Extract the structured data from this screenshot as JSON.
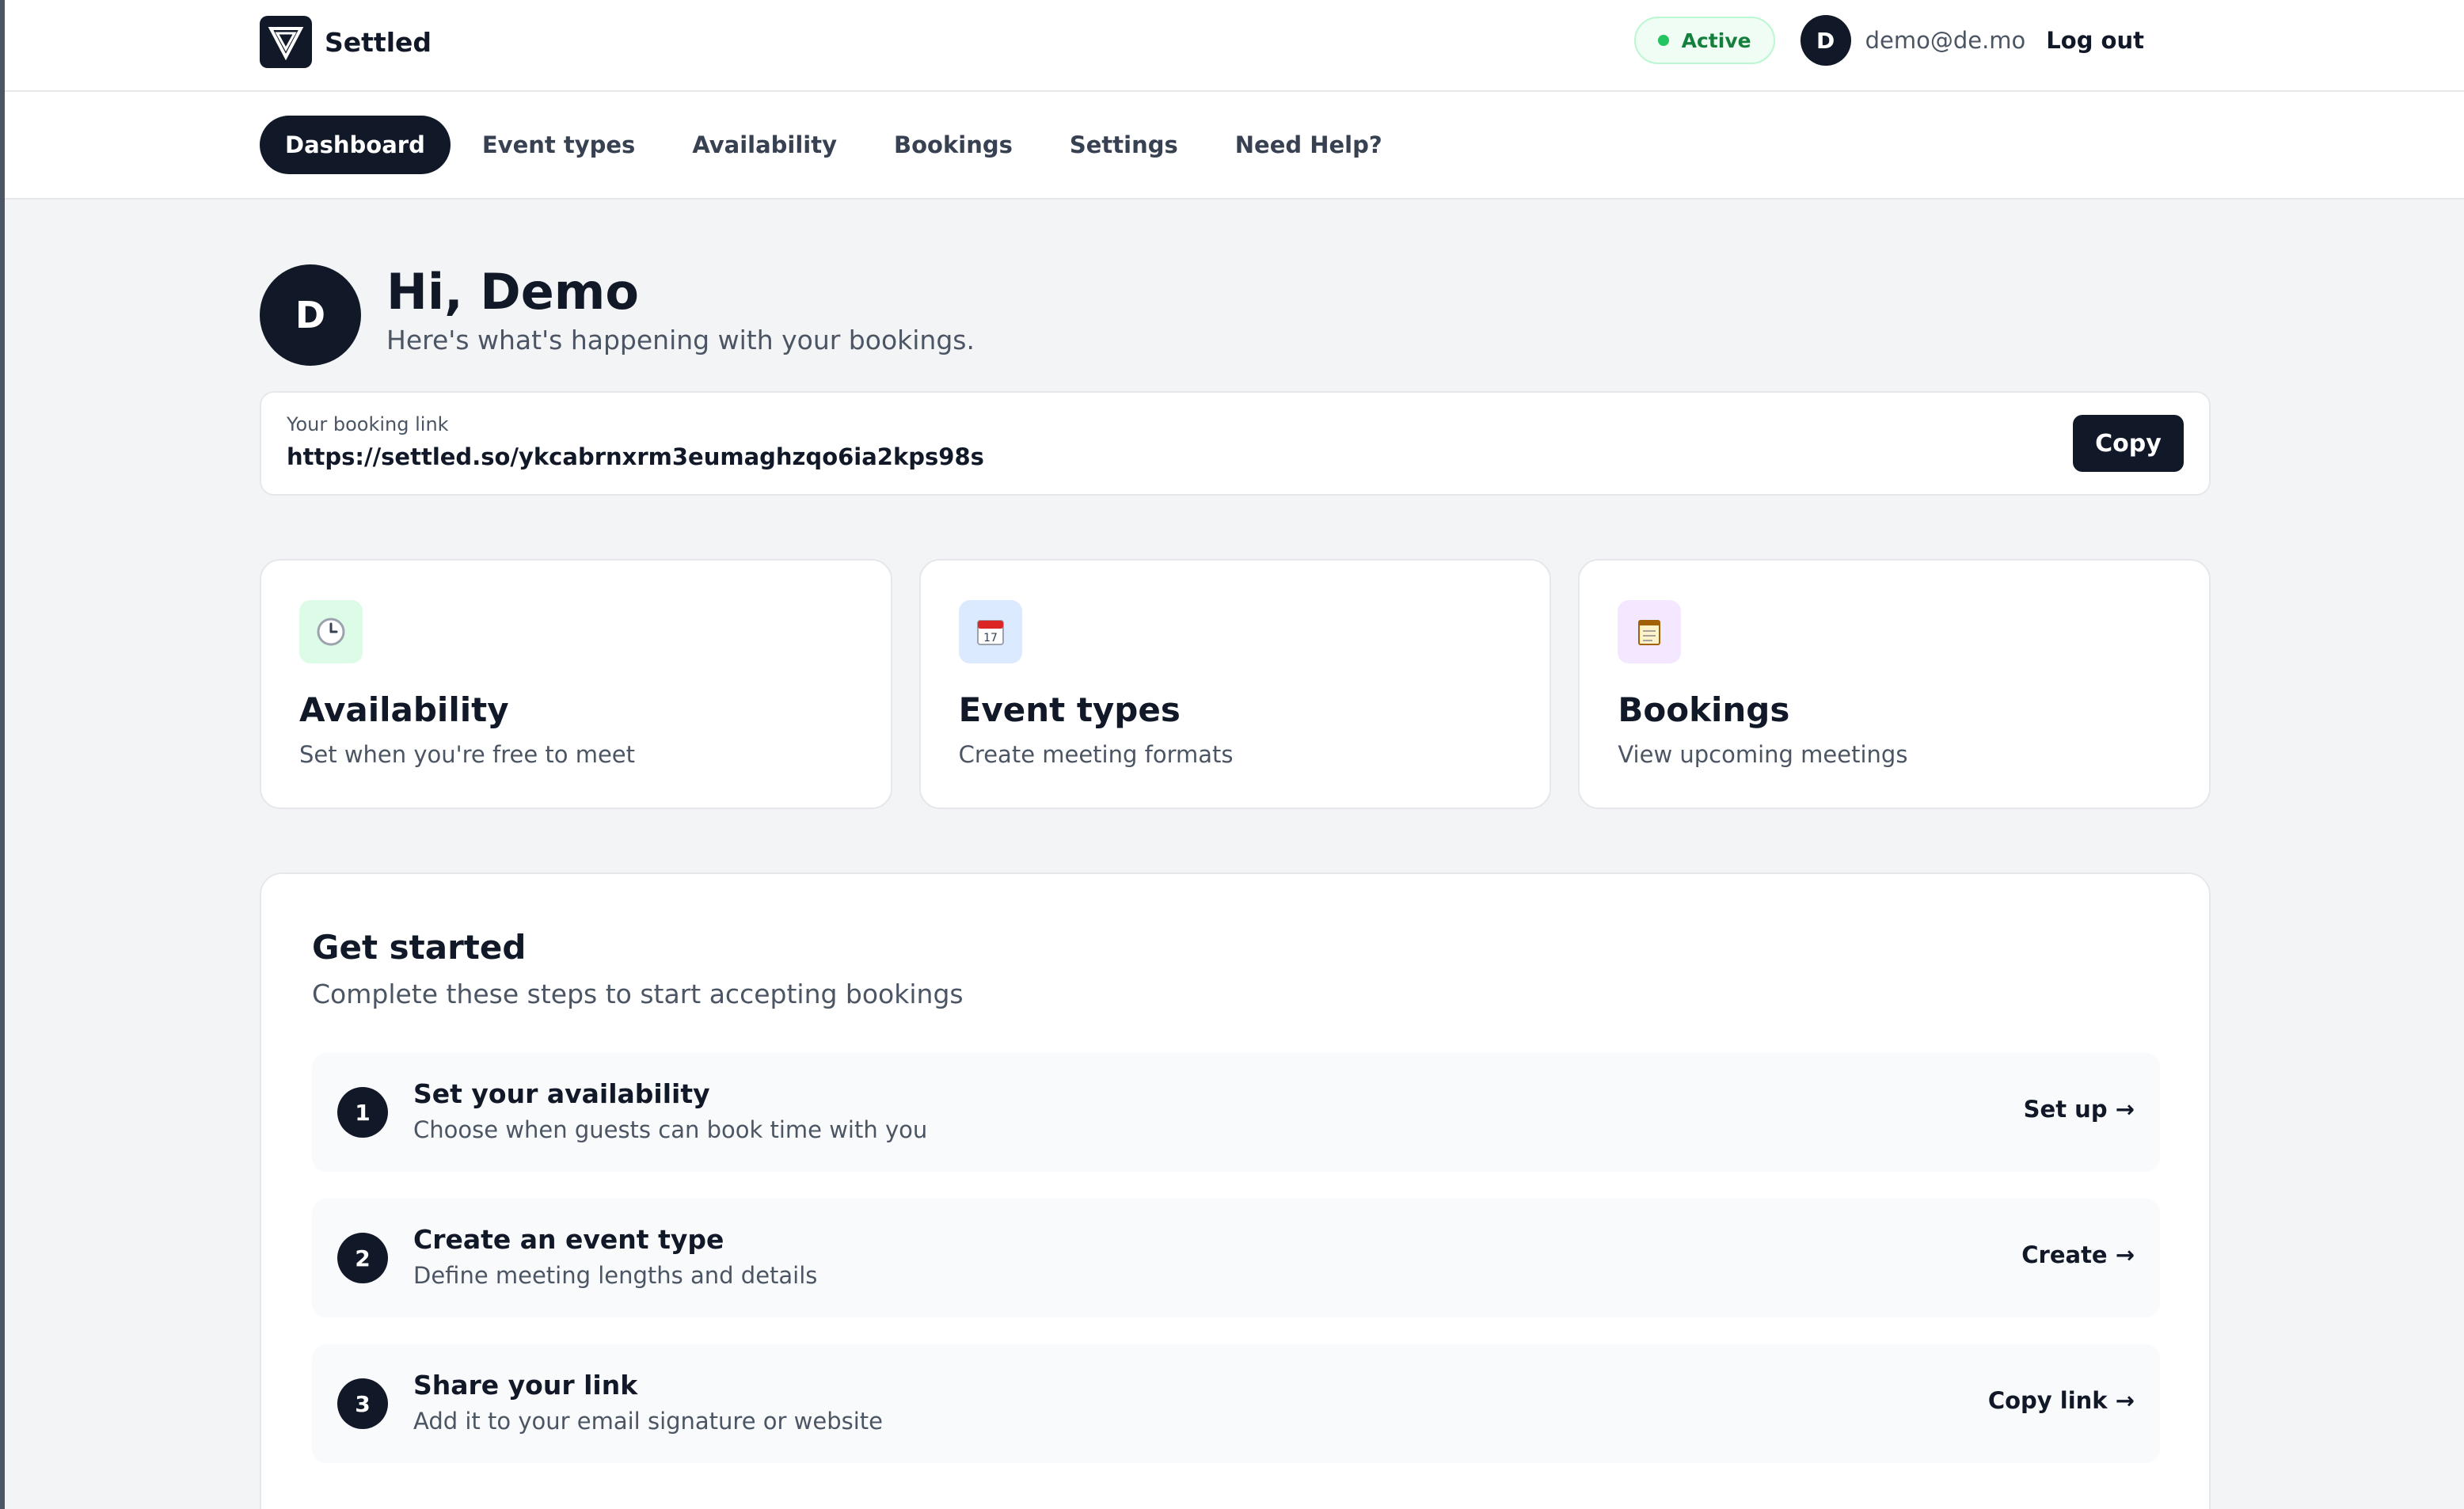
{
  "brand": {
    "name": "Settled",
    "icon": "triangle-logo-icon"
  },
  "header": {
    "status": "Active",
    "user_initial": "D",
    "user_email": "demo@de.mo",
    "logout": "Log out"
  },
  "nav": {
    "tabs": [
      {
        "label": "Dashboard",
        "active": true
      },
      {
        "label": "Event types"
      },
      {
        "label": "Availability"
      },
      {
        "label": "Bookings"
      },
      {
        "label": "Settings"
      },
      {
        "label": "Need Help?"
      }
    ]
  },
  "greeting": {
    "initial": "D",
    "title": "Hi, Demo",
    "subtitle": "Here's what's happening with your bookings."
  },
  "booking_link": {
    "label": "Your booking link",
    "url": "https://settled.so/ykcabrnxrm3eumaghzqo6ia2kps98s",
    "copy": "Copy"
  },
  "features": [
    {
      "title": "Availability",
      "desc": "Set when you're free to meet",
      "icon": "clock-icon",
      "bg": "#dcfce7"
    },
    {
      "title": "Event types",
      "desc": "Create meeting formats",
      "icon": "calendar-icon",
      "bg": "#dbeafe"
    },
    {
      "title": "Bookings",
      "desc": "View upcoming meetings",
      "icon": "notepad-icon",
      "bg": "#f3e8ff"
    }
  ],
  "get_started": {
    "title": "Get started",
    "subtitle": "Complete these steps to start accepting bookings",
    "steps": [
      {
        "num": "1",
        "title": "Set your availability",
        "desc": "Choose when guests can book time with you",
        "action": "Set up →"
      },
      {
        "num": "2",
        "title": "Create an event type",
        "desc": "Define meeting lengths and details",
        "action": "Create →"
      },
      {
        "num": "3",
        "title": "Share your link",
        "desc": "Add it to your email signature or website",
        "action": "Copy link →"
      }
    ]
  },
  "calendar_icon_text": "17"
}
